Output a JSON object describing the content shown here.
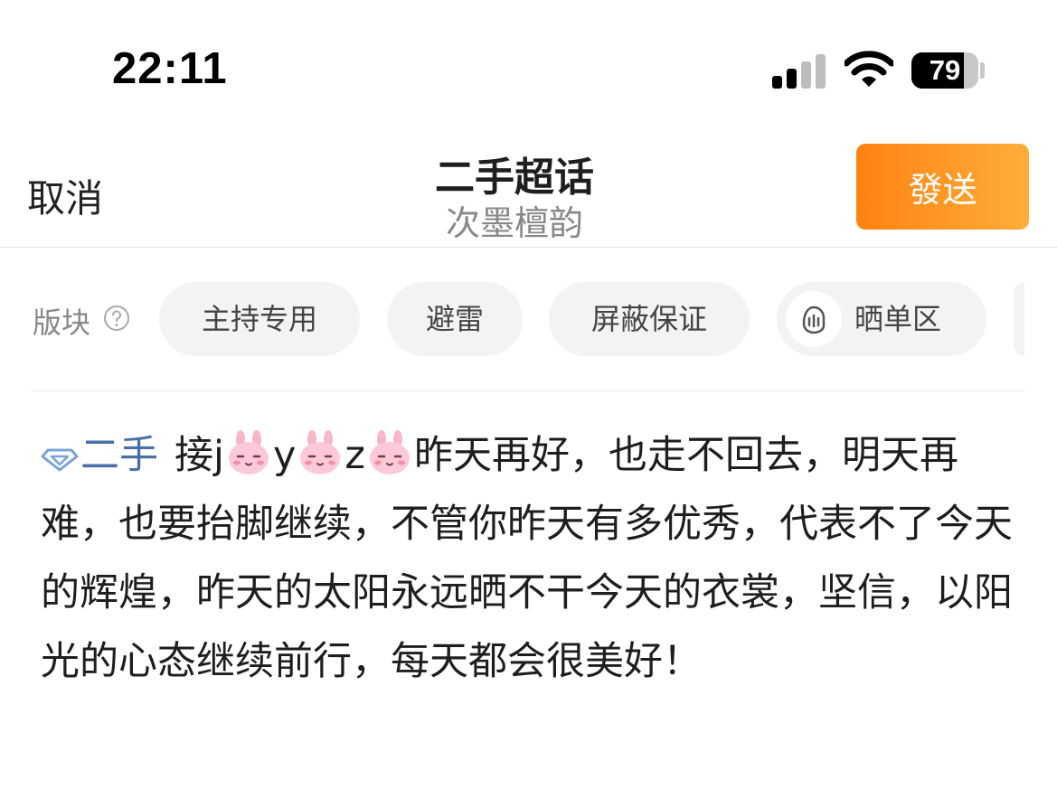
{
  "status_bar": {
    "time": "22:11",
    "battery_level": "79",
    "battery_fraction": 0.79
  },
  "nav": {
    "cancel_label": "取消",
    "title": "二手超话",
    "subtitle": "次墨檀韵",
    "send_label": "發送",
    "send_color": "#ff8212"
  },
  "section": {
    "label": "版块",
    "chips": [
      {
        "label": "主持专用"
      },
      {
        "label": "避雷"
      },
      {
        "label": "屏蔽保证"
      },
      {
        "label": "晒单区",
        "icon": "thumbs-up-icon"
      }
    ]
  },
  "post": {
    "topic_tag": "二手",
    "topic_color": "#4a6ea8",
    "seg1": "接j",
    "seg2": "y",
    "seg3": "z",
    "seg4": "昨天再好，也走不回去，明天再难，也要抬脚继续，不管你昨天有多优秀，代表不了今天的辉煌，昨天的太阳永远晒不干今天的衣裳，坚信，以阳光的心态继续前行，每天都会很美好！",
    "emoji": "pink-bunny-face-icon"
  }
}
